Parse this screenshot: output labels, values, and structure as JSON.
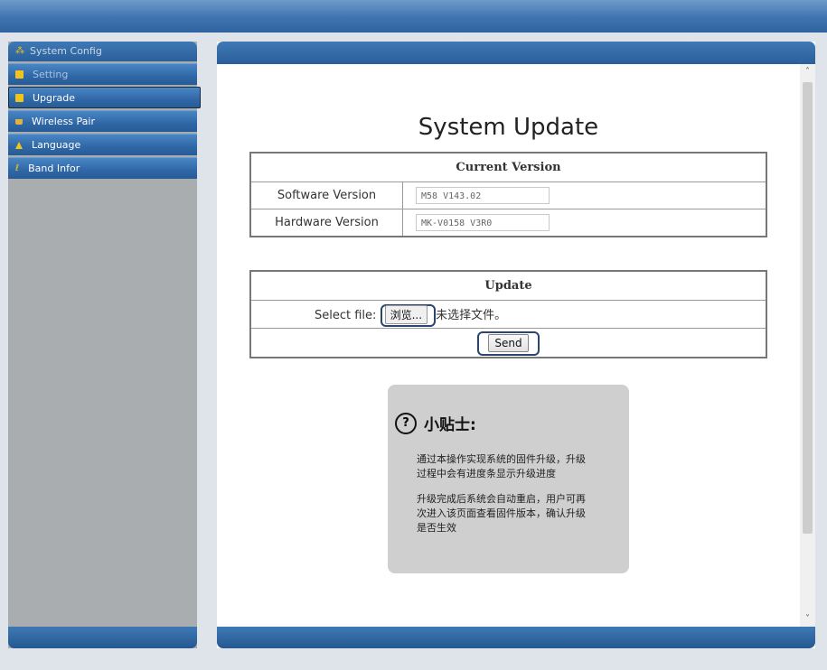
{
  "sidebar": {
    "header": "System Config",
    "items": [
      {
        "label": "Setting",
        "icon": "monitor-icon",
        "state": "dim"
      },
      {
        "label": "Upgrade",
        "icon": "disk-icon",
        "state": "active"
      },
      {
        "label": "Wireless Pair",
        "icon": "pair-icon",
        "state": "normal"
      },
      {
        "label": "Language",
        "icon": "home-icon",
        "state": "normal"
      },
      {
        "label": "Band Infor",
        "icon": "info-icon",
        "state": "normal"
      }
    ]
  },
  "main": {
    "title": "System Update",
    "current_version": {
      "header": "Current Version",
      "software_label": "Software Version",
      "software_value": "M58 V143.02",
      "hardware_label": "Hardware Version",
      "hardware_value": "MK-V0158  V3R0"
    },
    "update": {
      "header": "Update",
      "select_label": "Select file:",
      "browse_label": "浏览...",
      "no_file_text": "未选择文件。",
      "send_label": "Send"
    },
    "tip": {
      "icon": "question-icon",
      "title": "小贴士:",
      "para1": "通过本操作实现系统的固件升级，升级过程中会有进度条显示升级进度",
      "para2": "升级完成后系统会自动重启，用户可再次进入该页面查看固件版本，确认升级是否生效"
    }
  },
  "colors": {
    "accent": "#2f67a6",
    "sidebar_bg": "#a9adb0",
    "tip_bg": "#cfcfcf"
  }
}
